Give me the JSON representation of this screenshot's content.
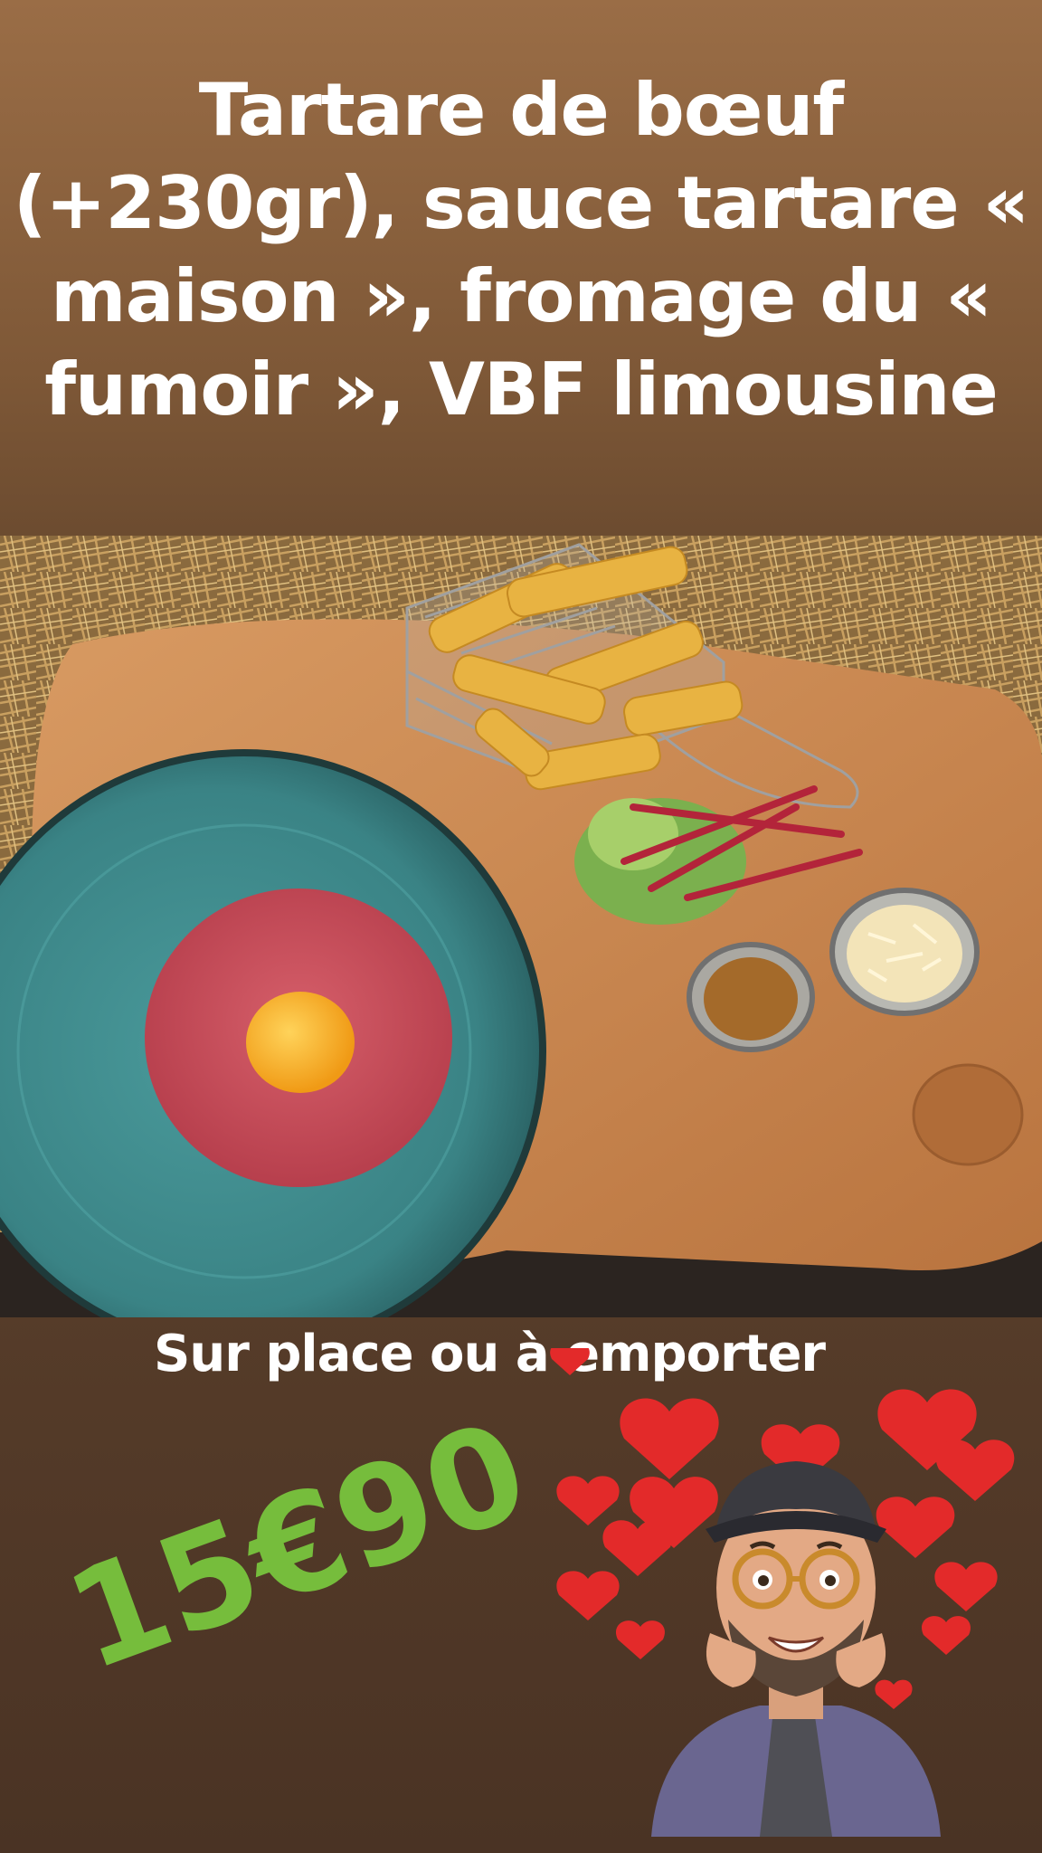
{
  "post": {
    "title": "Tartare de bœuf (+230gr), sauce tartare « maison », fromage du « fumoir », VBF limousine",
    "subtitle": "Sur place ou à emporter",
    "price": "15€90"
  },
  "colors": {
    "price_green": "#76bd3c",
    "plate_blue": "#3f8c8e",
    "board_wood": "#c8874e",
    "heart_red": "#e32a2a"
  },
  "photo": {
    "subject": "beef tartare with egg yolk, fries in wire basket, salad, sauce and grated cheese on a wooden board over straw"
  },
  "sticker": {
    "subject": "memoji-man-with-cap-and-glasses-surrounded-by-hearts"
  }
}
